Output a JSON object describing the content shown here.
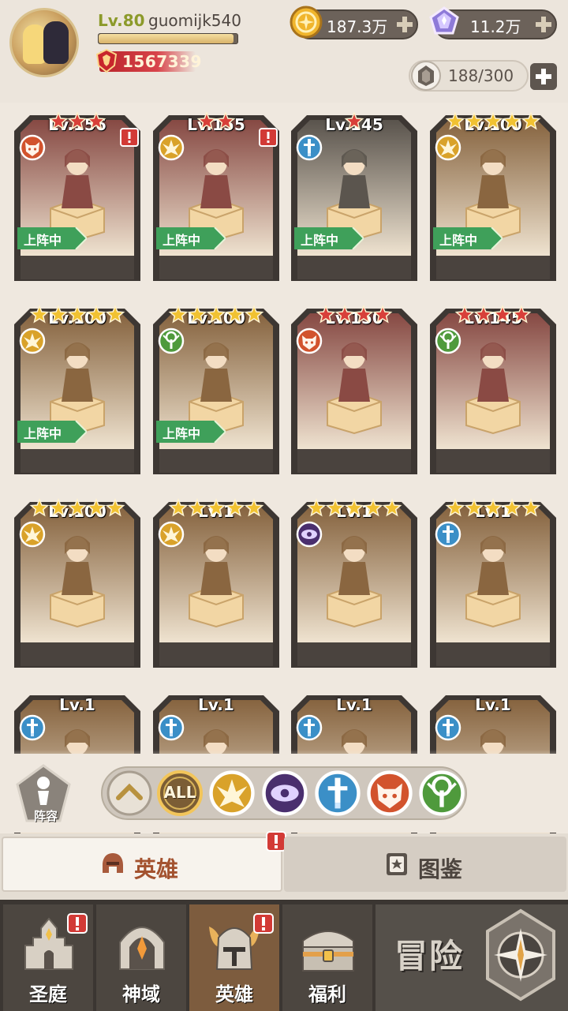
{
  "header": {
    "level_text": "Lv.80",
    "user_name": "guomijk540",
    "xp_progress": 0.97,
    "power_value": "1567339",
    "gold_value": "187.3万",
    "gem_value": "11.2万",
    "hero_slots": "188/300"
  },
  "heroes": [
    {
      "level": "Lv.156",
      "faction": "wolf",
      "deployed": true,
      "alert": true,
      "stars": 3,
      "star_color": "red",
      "frame_color": "#8a4a44"
    },
    {
      "level": "Lv.155",
      "faction": "light",
      "deployed": true,
      "alert": true,
      "stars": 2,
      "star_color": "red",
      "frame_color": "#8a4a44"
    },
    {
      "level": "Lv.145",
      "faction": "sword",
      "deployed": true,
      "alert": false,
      "stars": 1,
      "star_color": "red",
      "frame_color": "#5b554e"
    },
    {
      "level": "Lv.100",
      "faction": "light",
      "deployed": true,
      "alert": false,
      "stars": 5,
      "star_color": "gold",
      "frame_color": "#8a6640"
    },
    {
      "level": "Lv.100",
      "faction": "light",
      "deployed": true,
      "alert": false,
      "stars": 5,
      "star_color": "gold",
      "frame_color": "#8a6640"
    },
    {
      "level": "Lv.100",
      "faction": "nature",
      "deployed": true,
      "alert": false,
      "stars": 5,
      "star_color": "gold",
      "frame_color": "#8a6640"
    },
    {
      "level": "Lv.150",
      "faction": "wolf",
      "deployed": false,
      "alert": false,
      "stars": 4,
      "star_color": "red",
      "frame_color": "#8a4a44"
    },
    {
      "level": "Lv.145",
      "faction": "nature",
      "deployed": false,
      "alert": false,
      "stars": 4,
      "star_color": "red",
      "frame_color": "#8a4a44"
    },
    {
      "level": "Lv.100",
      "faction": "light",
      "deployed": false,
      "alert": false,
      "stars": 5,
      "star_color": "gold",
      "frame_color": "#8a6640"
    },
    {
      "level": "Lv.1",
      "faction": "light",
      "deployed": false,
      "alert": false,
      "stars": 5,
      "star_color": "gold",
      "frame_color": "#8a6640"
    },
    {
      "level": "Lv.1",
      "faction": "dark",
      "deployed": false,
      "alert": false,
      "stars": 5,
      "star_color": "gold",
      "frame_color": "#8a6640"
    },
    {
      "level": "Lv.1",
      "faction": "sword",
      "deployed": false,
      "alert": false,
      "stars": 5,
      "star_color": "gold",
      "frame_color": "#8a6640"
    },
    {
      "level": "Lv.1",
      "faction": "sword",
      "deployed": false,
      "alert": false,
      "stars": 0,
      "star_color": "gold",
      "frame_color": "#8a6640"
    },
    {
      "level": "Lv.1",
      "faction": "sword",
      "deployed": false,
      "alert": false,
      "stars": 0,
      "star_color": "gold",
      "frame_color": "#8a6640"
    },
    {
      "level": "Lv.1",
      "faction": "sword",
      "deployed": false,
      "alert": false,
      "stars": 0,
      "star_color": "gold",
      "frame_color": "#8a6640"
    },
    {
      "level": "Lv.1",
      "faction": "sword",
      "deployed": false,
      "alert": false,
      "stars": 0,
      "star_color": "gold",
      "frame_color": "#8a6640"
    }
  ],
  "deployed_label": "上阵中",
  "filter": {
    "lineup_label": "阵容",
    "all_label": "ALL",
    "chips": [
      "sort-up",
      "all",
      "light",
      "dark",
      "sword",
      "wolf",
      "nature"
    ],
    "selected": "all"
  },
  "tabs": {
    "heroes_label": "英雄",
    "codex_label": "图鉴",
    "selected": "heroes"
  },
  "nav": {
    "sanctuary_label": "圣庭",
    "divine_label": "神域",
    "heroes_label": "英雄",
    "welfare_label": "福利",
    "adventure_label": "冒险",
    "selected": "heroes"
  },
  "colors": {
    "light_faction": "#d9a22a",
    "dark_faction": "#4a2f6e",
    "sword_faction": "#3b8fc7",
    "wolf_faction": "#d2532d",
    "nature_faction": "#4f9a3c",
    "deploy_green": "#3fa05a",
    "star_gold": "#f1c232",
    "star_red": "#d8403a",
    "alert_red": "#d23a36"
  }
}
